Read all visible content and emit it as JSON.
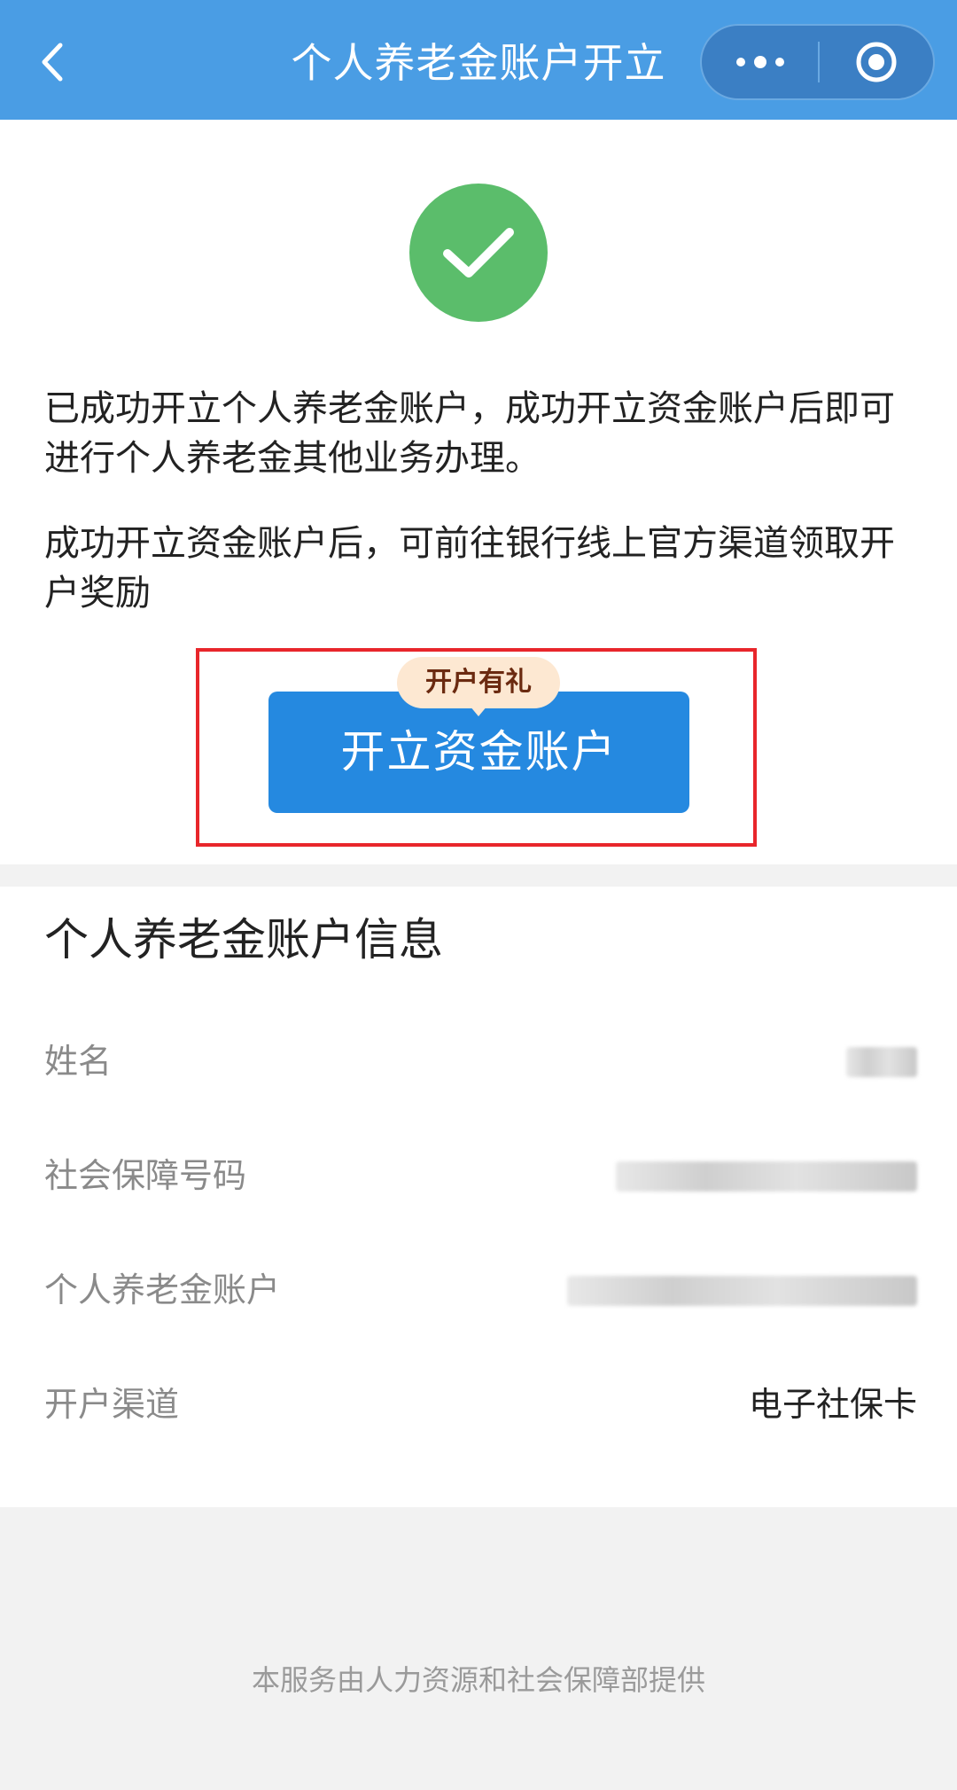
{
  "header": {
    "title": "个人养老金账户开立",
    "back_icon": "chevron-left-icon",
    "more_icon": "more-dots-icon",
    "close_icon": "target-circle-icon",
    "background": "#4a9de4"
  },
  "success": {
    "icon": "check-icon",
    "color": "#5bbd6b",
    "message1": "已成功开立个人养老金账户，成功开立资金账户后即可进行个人养老金其他业务办理。",
    "message2": "成功开立资金账户后，可前往银行线上官方渠道领取开户奖励"
  },
  "action": {
    "gift_tag": "开户有礼",
    "button_label": "开立资金账户",
    "button_color": "#2589e0",
    "highlight_color": "#e8262b"
  },
  "info": {
    "title": "个人养老金账户信息",
    "rows": [
      {
        "label": "姓名",
        "value": ""
      },
      {
        "label": "社会保障号码",
        "value": ""
      },
      {
        "label": "个人养老金账户",
        "value": ""
      },
      {
        "label": "开户渠道",
        "value": "电子社保卡"
      }
    ]
  },
  "footer": {
    "text": "本服务由人力资源和社会保障部提供"
  }
}
